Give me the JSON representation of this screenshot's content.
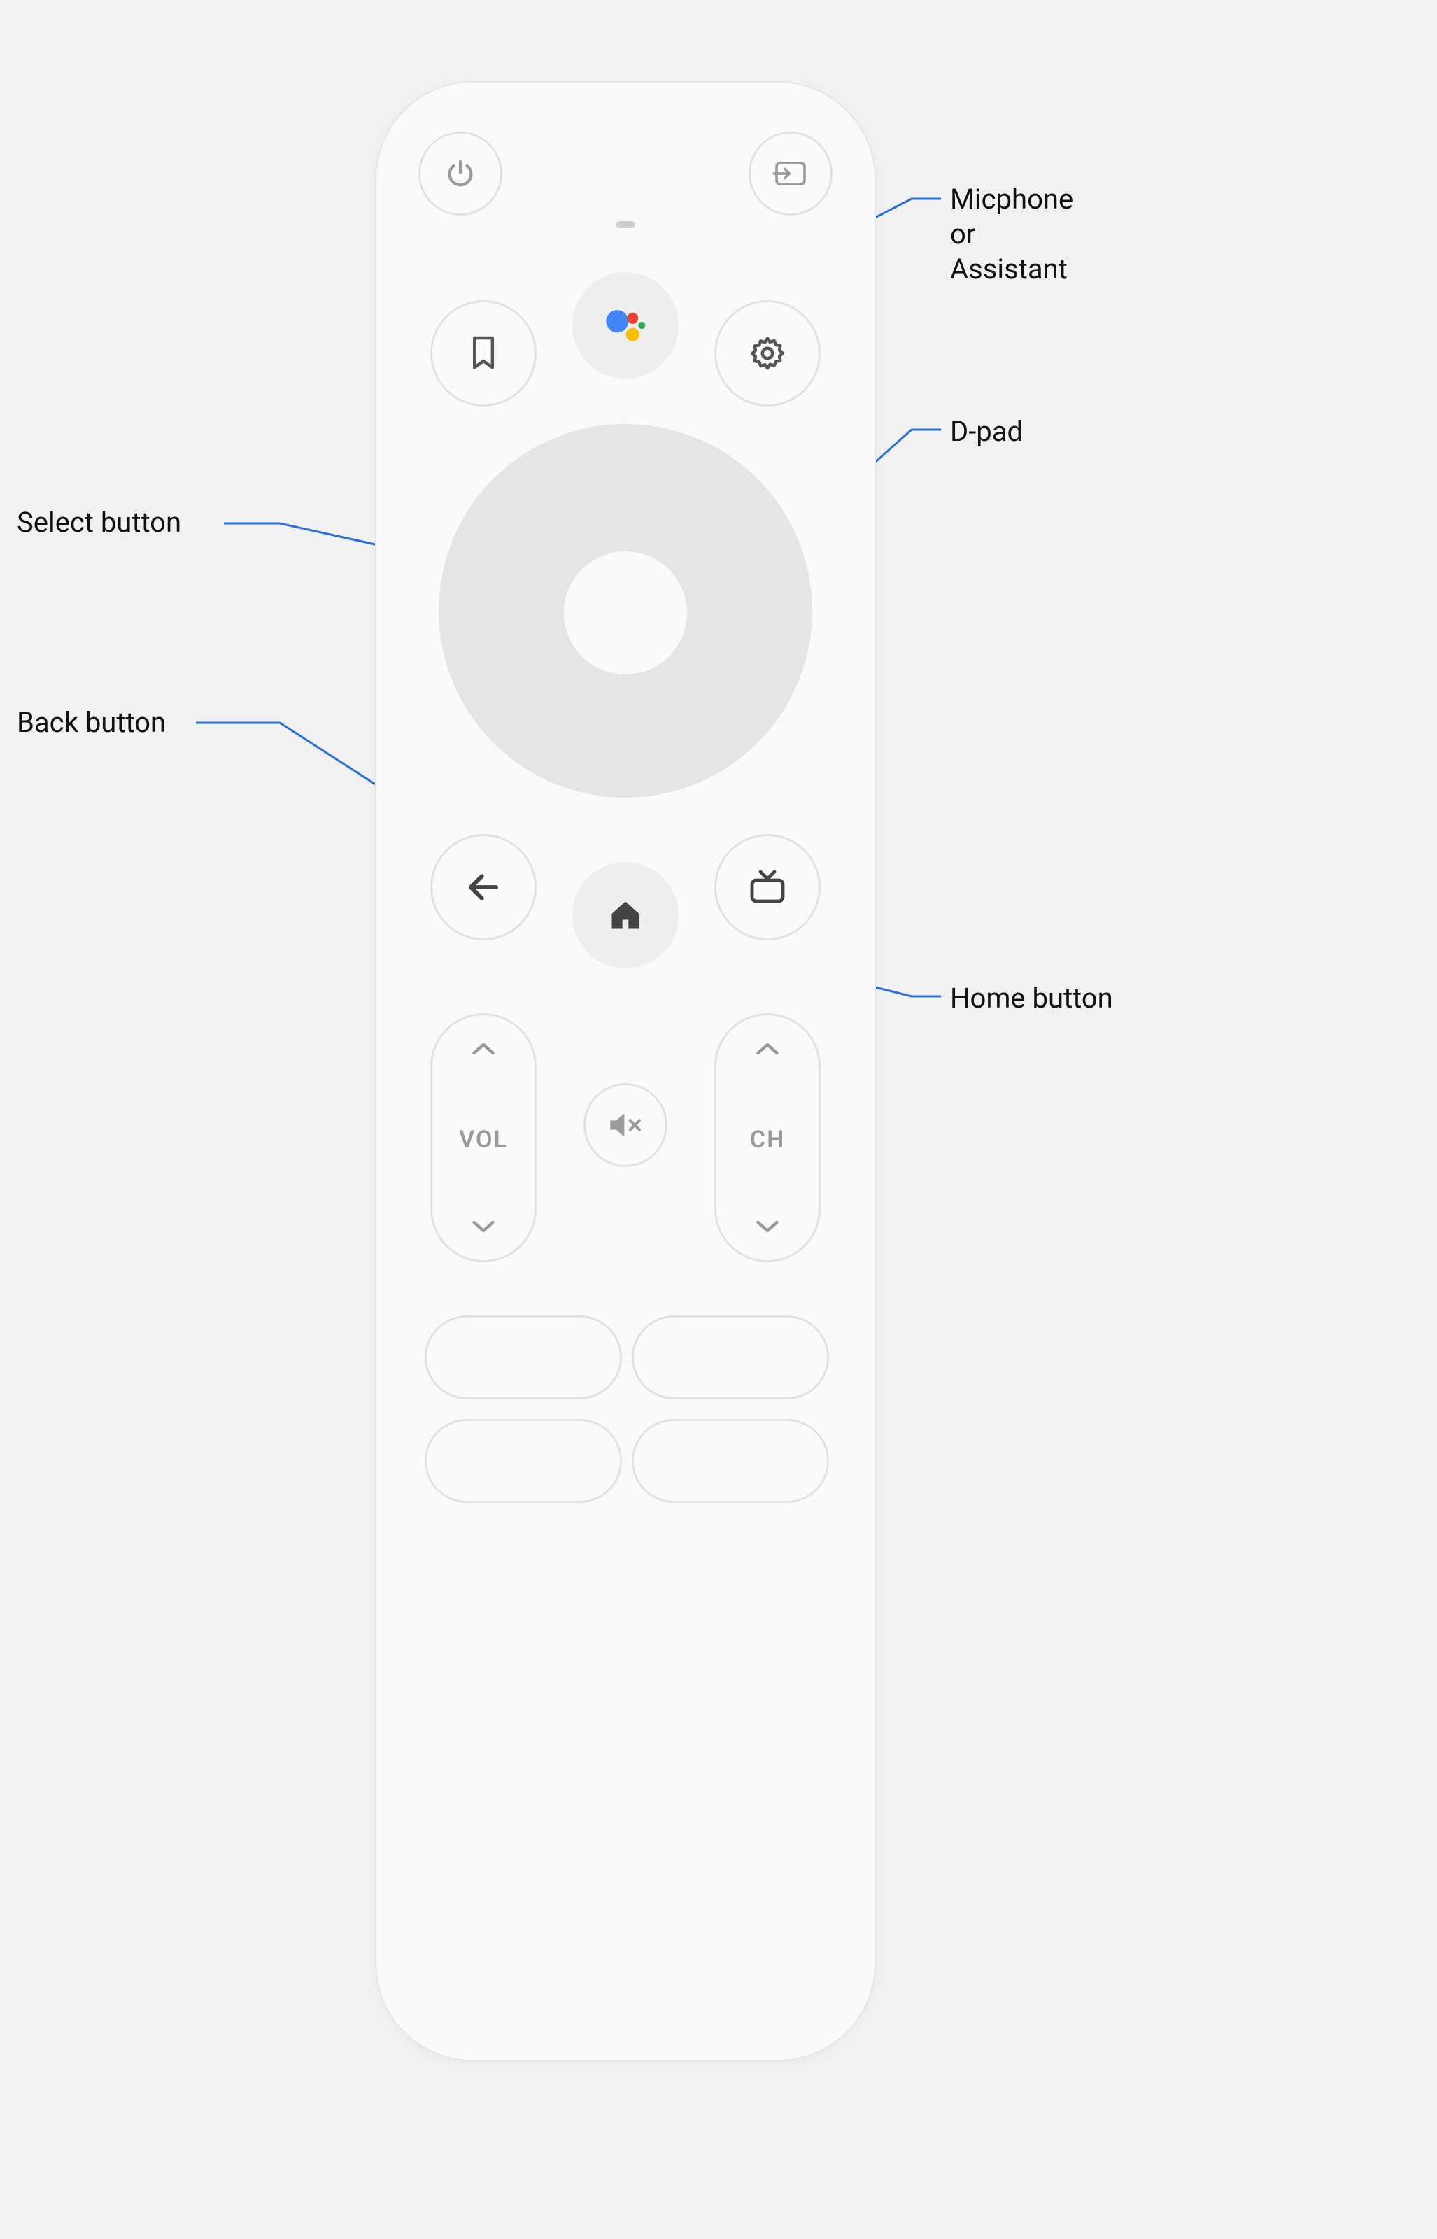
{
  "callouts": {
    "microphone": "Micphone\nor\nAssistant",
    "dpad": "D-pad",
    "home": "Home button",
    "select": "Select button",
    "back": "Back button"
  },
  "remote": {
    "volume_label": "VOL",
    "channel_label": "CH",
    "buttons": {
      "power": "power",
      "input": "input",
      "bookmark": "bookmark",
      "assistant": "assistant",
      "settings": "settings",
      "back": "back",
      "home": "home",
      "guide": "live-guide",
      "mute": "mute"
    }
  }
}
